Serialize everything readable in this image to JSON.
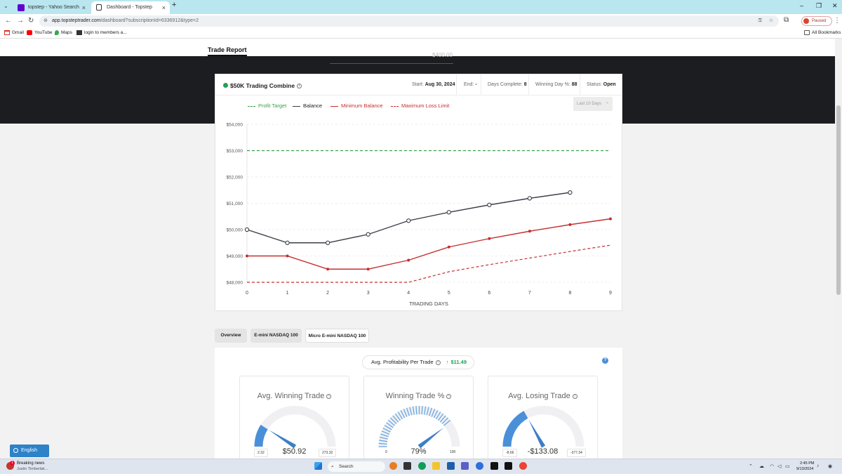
{
  "browser": {
    "tabs": [
      {
        "label": "topstep - Yahoo Search Results",
        "close": "×"
      },
      {
        "label": "Dashboard - Topstep",
        "close": "×"
      }
    ],
    "new_tab": "+",
    "url_host": "app.topsteptrader.com",
    "url_path": "/dashboard?subscriptionId=6336912&type=2",
    "profile_status": "Paused",
    "bookmarks": [
      "Gmail",
      "YouTube",
      "Maps",
      "login to members a..."
    ],
    "all_bookmarks": "All Bookmarks",
    "window_controls": {
      "minimize": "–",
      "maximize": "❐",
      "close": "✕"
    }
  },
  "page": {
    "section_title": "Trade Report",
    "dark_partial_value": "$400.00"
  },
  "combine": {
    "title": "$50K Trading Combine",
    "info": "i",
    "start_label": "Start:",
    "start_value": "Aug 30, 2024",
    "end_label": "End:",
    "end_value": "-",
    "days_complete_label": "Days Complete:",
    "days_complete_value": "8",
    "winning_day_label": "Winning Day %:",
    "winning_day_value": "88",
    "status_label": "Status:",
    "status_value": "Open",
    "range_select": "Last 10 Days",
    "range_caret": "⌄"
  },
  "chart_data": {
    "type": "line",
    "x": [
      0,
      1,
      2,
      3,
      4,
      5,
      6,
      7,
      8,
      9
    ],
    "xlabel": "TRADING DAYS",
    "ylim": [
      48000,
      54000
    ],
    "yticks": [
      48000,
      49000,
      50000,
      51000,
      52000,
      53000,
      54000
    ],
    "ytick_labels": [
      "$48,000",
      "$49,000",
      "$50,000",
      "$51,000",
      "$52,000",
      "$53,000",
      "$54,000"
    ],
    "grid": true,
    "legend_position": "top-left",
    "series": [
      {
        "name": "Profit Target",
        "style": "dashed",
        "color": "#3aa14a",
        "x": [
          0,
          9
        ],
        "values": [
          53000,
          53000
        ]
      },
      {
        "name": "Balance",
        "style": "solid-markers-hollow",
        "color": "#3b3f47",
        "x": [
          0,
          1,
          2,
          3,
          4,
          5,
          6,
          7,
          8
        ],
        "values": [
          50000,
          49500,
          49500,
          49820,
          50340,
          50660,
          50940,
          51190,
          51410
        ]
      },
      {
        "name": "Minimum Balance",
        "style": "solid-markers-filled",
        "color": "#c62f2f",
        "x": [
          0,
          1,
          2,
          3,
          4,
          5,
          6,
          7,
          8,
          9
        ],
        "values": [
          49000,
          49000,
          48500,
          48500,
          48840,
          49340,
          49660,
          49940,
          50190,
          50410
        ]
      },
      {
        "name": "Maximum Loss Limit",
        "style": "dashed",
        "color": "#c62f2f",
        "x": [
          0,
          1,
          2,
          3,
          4,
          5,
          6,
          7,
          8,
          9
        ],
        "values": [
          48000,
          48000,
          48000,
          48000,
          48000,
          48400,
          48670,
          48920,
          49170,
          49410
        ]
      }
    ]
  },
  "tabs_row": [
    "Overview",
    "E-mini NASDAQ 100",
    "Micro E-mini NASDAQ 100"
  ],
  "profitability": {
    "label": "Avg. Profitability Per Trade",
    "info": "i",
    "arrow": "↑",
    "value": "$11.49",
    "help": "?"
  },
  "gauges": [
    {
      "title": "Avg. Winning Trade",
      "value": "$50.92",
      "min": "2.32",
      "max": "273.32",
      "fraction": 0.18
    },
    {
      "title": "Winning Trade %",
      "value": "79%",
      "min": "0",
      "max": "100",
      "fraction": 0.79
    },
    {
      "title": "Avg. Losing Trade",
      "value": "-$133.08",
      "min": "-8.66",
      "max": "-377.34",
      "fraction": 0.34
    }
  ],
  "language_button": "English",
  "taskbar": {
    "news_title": "Breaking news",
    "news_sub": "Justin Timberlak...",
    "news_badge": "1",
    "search": "Search",
    "time": "2:45 PM",
    "date": "9/13/2024"
  },
  "colors": {
    "accent_blue": "#4a90d9",
    "profit_green": "#3aa14a",
    "loss_red": "#c62f2f",
    "balance_dark": "#3b3f47"
  }
}
